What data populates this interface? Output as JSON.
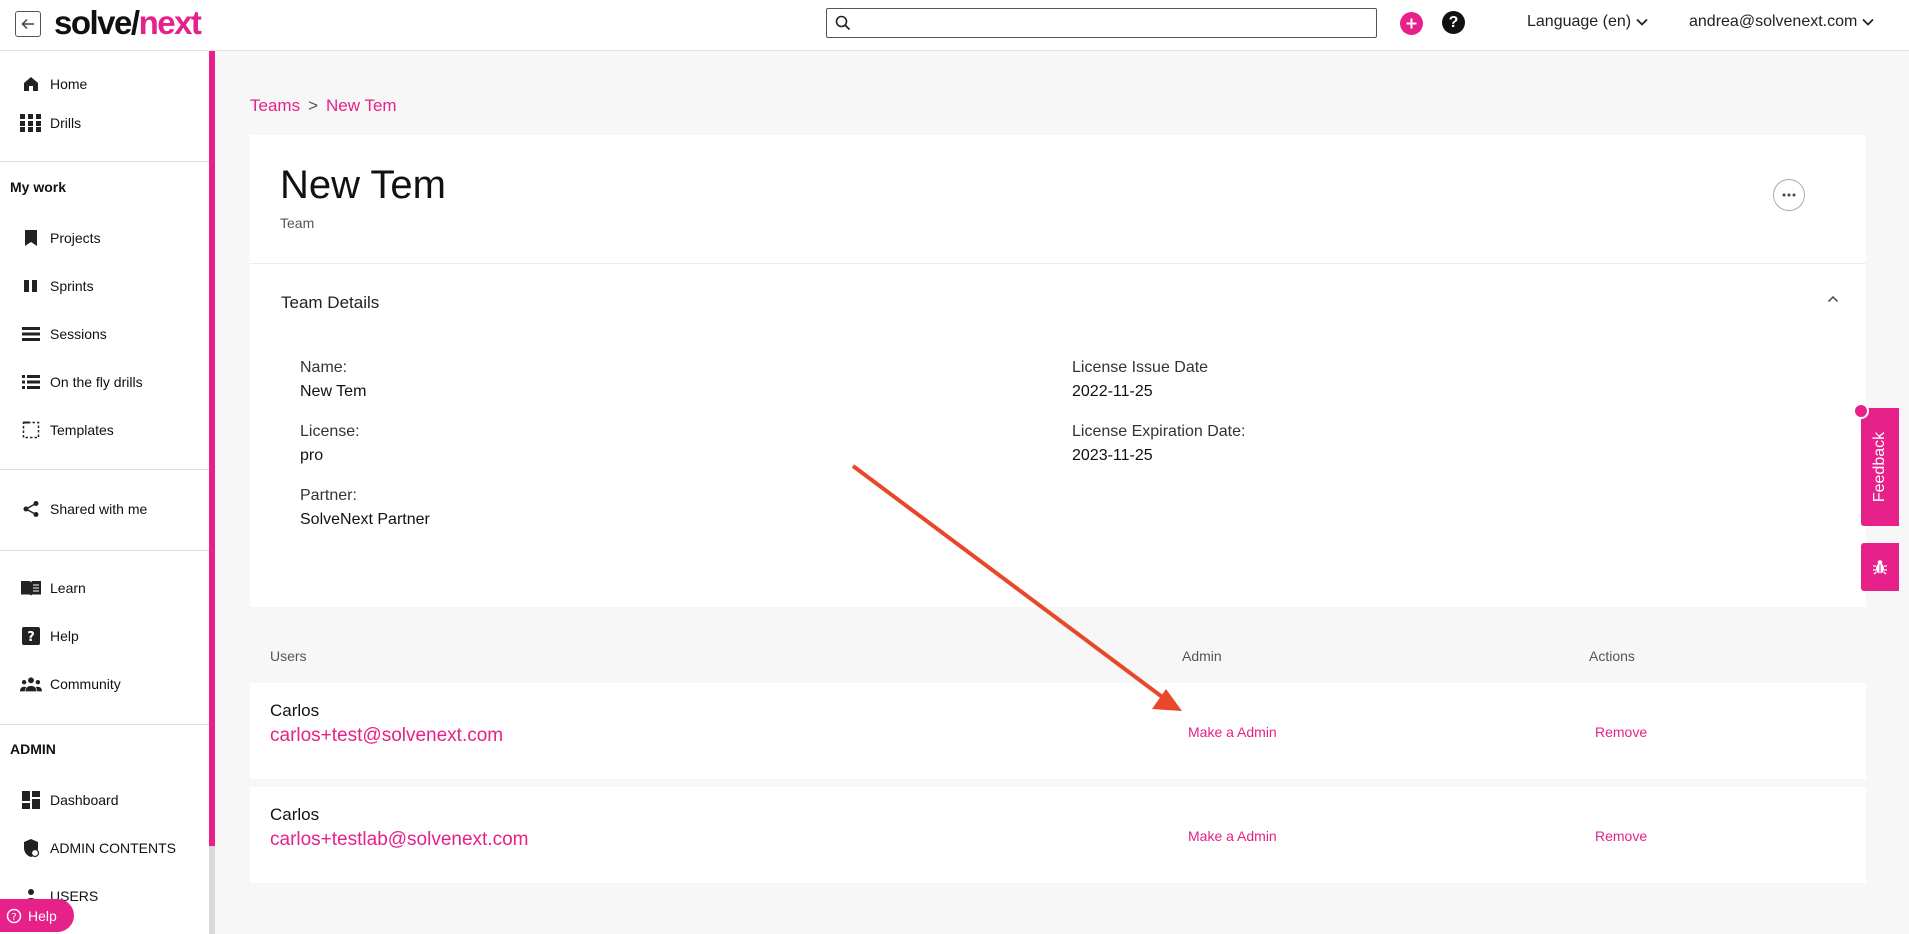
{
  "topbar": {
    "logo_part1": "solve/",
    "logo_part2": "next",
    "search_placeholder": "",
    "language": "Language (en)",
    "user_email": "andrea@solvenext.com"
  },
  "sidebar": {
    "items_top": [
      {
        "label": "Home",
        "icon": "home-icon"
      },
      {
        "label": "Drills",
        "icon": "grid-icon"
      }
    ],
    "my_work_title": "My work",
    "my_work": [
      {
        "label": "Projects",
        "icon": "bookmark-icon"
      },
      {
        "label": "Sprints",
        "icon": "columns-icon"
      },
      {
        "label": "Sessions",
        "icon": "list-icon"
      },
      {
        "label": "On the fly drills",
        "icon": "list-detail-icon"
      },
      {
        "label": "Templates",
        "icon": "template-icon"
      }
    ],
    "shared": {
      "label": "Shared with me",
      "icon": "share-icon"
    },
    "support": [
      {
        "label": "Learn",
        "icon": "book-icon"
      },
      {
        "label": "Help",
        "icon": "question-icon"
      },
      {
        "label": "Community",
        "icon": "people-icon"
      }
    ],
    "admin_title": "ADMIN",
    "admin": [
      {
        "label": "Dashboard",
        "icon": "dashboard-icon"
      },
      {
        "label": "ADMIN CONTENTS",
        "icon": "shield-icon"
      },
      {
        "label": "USERS",
        "icon": "users-icon"
      }
    ],
    "help_pill": "Help"
  },
  "breadcrumb": {
    "items": [
      "Teams",
      "New Tem"
    ],
    "separator": ">"
  },
  "team": {
    "title": "New Tem",
    "subtitle": "Team",
    "details_title": "Team Details",
    "fields": {
      "name_label": "Name:",
      "name_value": "New Tem",
      "license_label": "License:",
      "license_value": "pro",
      "partner_label": "Partner:",
      "partner_value": "SolveNext Partner",
      "issue_label": "License Issue Date",
      "issue_value": "2022-11-25",
      "expiration_label": "License Expiration Date:",
      "expiration_value": "2023-11-25"
    }
  },
  "users_table": {
    "headers": [
      "Users",
      "Admin",
      "Actions"
    ],
    "rows": [
      {
        "name": "Carlos",
        "email": "carlos+test@solvenext.com",
        "admin_action": "Make a Admin",
        "action": "Remove"
      },
      {
        "name": "Carlos",
        "email": "carlos+testlab@solvenext.com",
        "admin_action": "Make a Admin",
        "action": "Remove"
      }
    ]
  },
  "feedback": {
    "label": "Feedback"
  },
  "colors": {
    "accent": "#e6218a",
    "annotation_arrow": "#e8472a"
  }
}
